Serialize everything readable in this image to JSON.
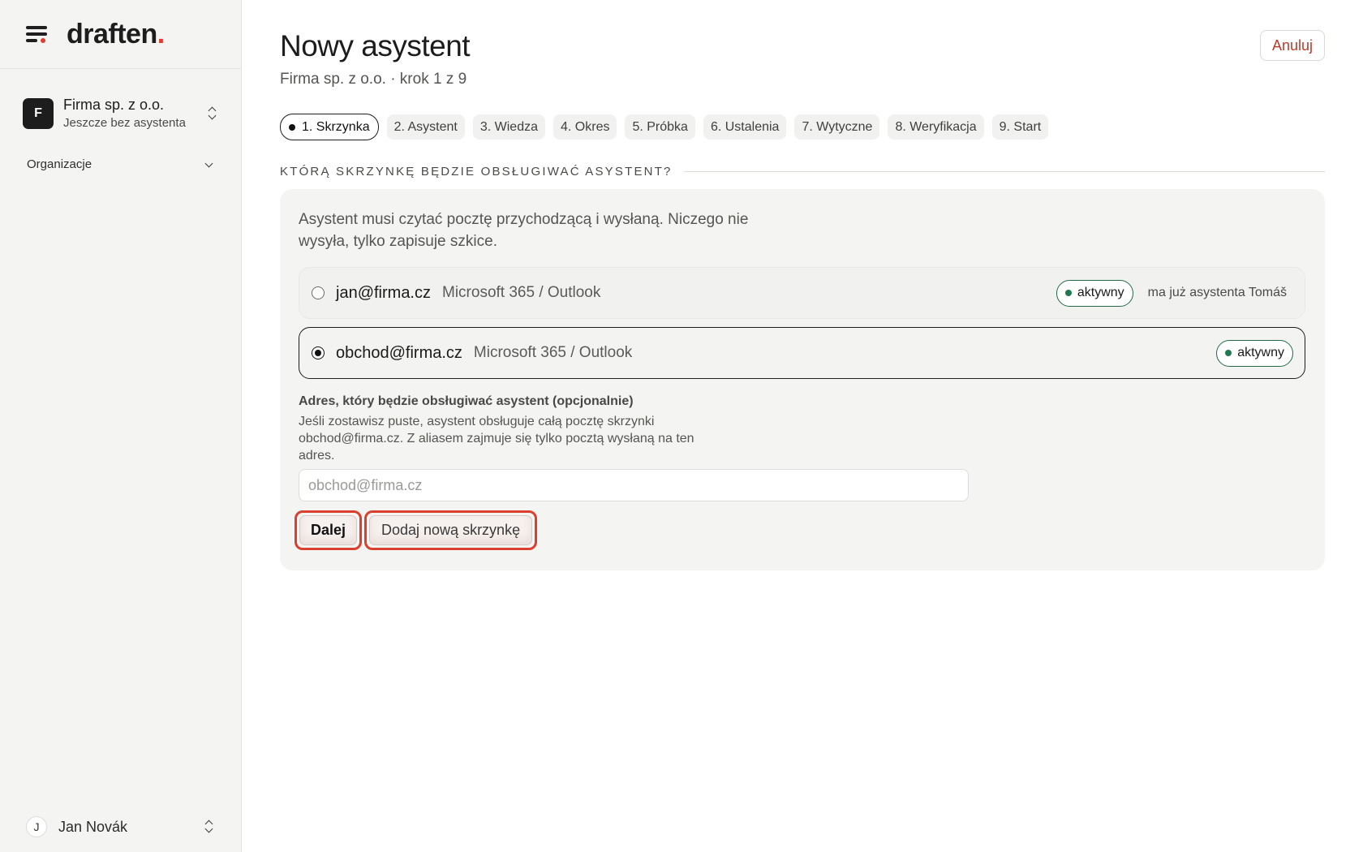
{
  "brand": {
    "logo_text": "draften",
    "logo_dot": "."
  },
  "sidebar": {
    "org": {
      "initial": "F",
      "name": "Firma sp. z o.o.",
      "subtitle": "Jeszcze bez asystenta"
    },
    "section_label": "Organizacje",
    "user": {
      "initial": "J",
      "name": "Jan Novák"
    }
  },
  "header": {
    "title": "Nowy asystent",
    "subtitle": "Firma sp. z o.o. · krok 1 z 9",
    "cancel_label": "Anuluj"
  },
  "steps": [
    {
      "label": "1. Skrzynka",
      "active": true
    },
    {
      "label": "2. Asystent",
      "active": false
    },
    {
      "label": "3. Wiedza",
      "active": false
    },
    {
      "label": "4. Okres",
      "active": false
    },
    {
      "label": "5. Próbka",
      "active": false
    },
    {
      "label": "6. Ustalenia",
      "active": false
    },
    {
      "label": "7. Wytyczne",
      "active": false
    },
    {
      "label": "8. Weryfikacja",
      "active": false
    },
    {
      "label": "9. Start",
      "active": false
    }
  ],
  "section": {
    "label": "KTÓRĄ SKRZYNKĘ BĘDZIE OBSŁUGIWAĆ ASYSTENT?"
  },
  "card": {
    "description": "Asystent musi czytać pocztę przychodzącą i wysłaną. Niczego nie wysyła, tylko zapisuje szkice.",
    "mailboxes": [
      {
        "email": "jan@firma.cz",
        "provider": "Microsoft 365 / Outlook",
        "status": "aktywny",
        "note": "ma już asystenta Tomáš",
        "selected": false
      },
      {
        "email": "obchod@firma.cz",
        "provider": "Microsoft 365 / Outlook",
        "status": "aktywny",
        "note": "",
        "selected": true
      }
    ],
    "alias": {
      "label": "Adres, który będzie obsługiwać asystent (opcjonalnie)",
      "help": "Jeśli zostawisz puste, asystent obsługuje całą pocztę skrzynki obchod@firma.cz. Z aliasem zajmuje się tylko pocztą wysłaną na ten adres.",
      "value": "",
      "placeholder": "obchod@firma.cz"
    },
    "next_label": "Dalej",
    "add_mailbox_label": "Dodaj nową skrzynkę"
  },
  "colors": {
    "accent_red": "#e03c31",
    "highlight_outline": "#d9402f",
    "status_green": "#1f7a4f",
    "sidebar_bg": "#f4f4f2"
  }
}
